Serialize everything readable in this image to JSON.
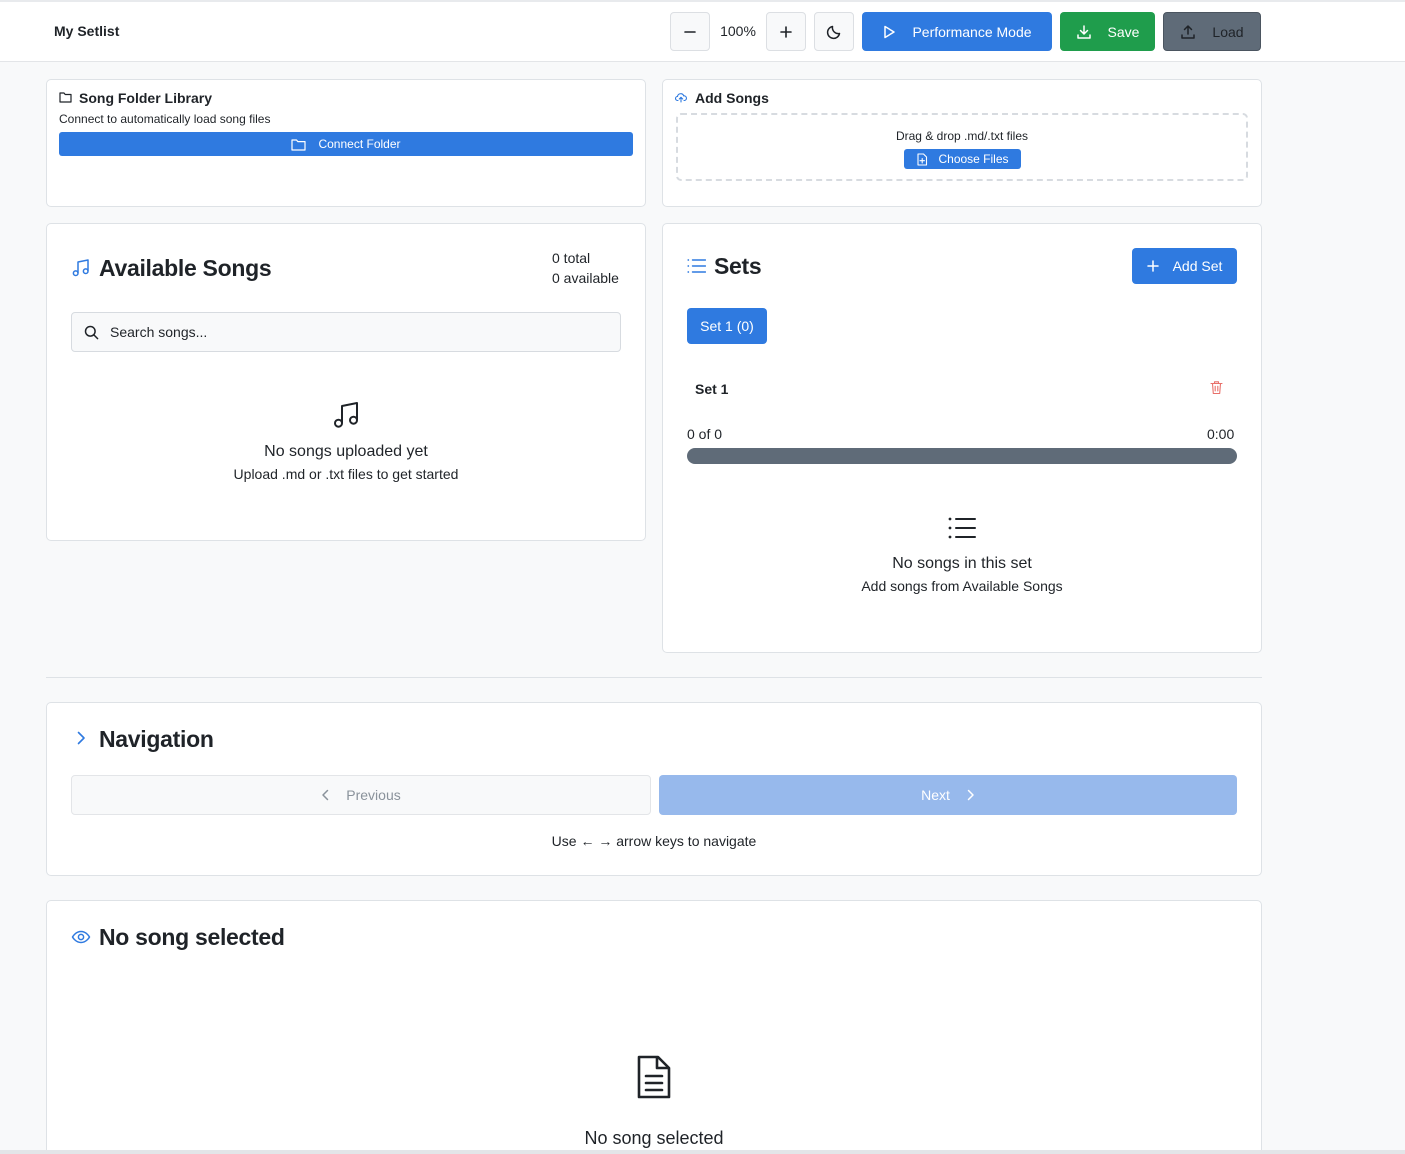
{
  "header": {
    "title": "My Setlist",
    "zoom_level": "100%",
    "performance_label": "Performance Mode",
    "save_label": "Save",
    "load_label": "Load"
  },
  "folder_library": {
    "title": "Song Folder Library",
    "description": "Connect to automatically load song files",
    "connect_label": "Connect Folder"
  },
  "add_songs": {
    "title": "Add Songs",
    "drop_text": "Drag & drop .md/.txt files",
    "choose_label": "Choose Files"
  },
  "available_songs": {
    "title": "Available Songs",
    "total": "0 total",
    "available": "0 available",
    "search_placeholder": "Search songs...",
    "empty_title": "No songs uploaded yet",
    "empty_subtitle": "Upload .md or .txt files to get started"
  },
  "sets": {
    "title": "Sets",
    "add_label": "Add Set",
    "tabs": [
      {
        "label": "Set 1 (0)",
        "active": true
      }
    ],
    "current": {
      "name": "Set 1",
      "count": "0 of 0",
      "duration": "0:00",
      "progress": 0
    },
    "empty_title": "No songs in this set",
    "empty_subtitle": "Add songs from Available Songs"
  },
  "navigation": {
    "title": "Navigation",
    "previous_label": "Previous",
    "next_label": "Next",
    "hint": "Use ← → arrow keys to navigate"
  },
  "viewer": {
    "title": "No song selected",
    "empty_title": "No song selected"
  },
  "colors": {
    "accent": "#2f7ae0",
    "save": "#1f9d4c",
    "load": "#5f6b78",
    "delete": "#e8706a",
    "next_disabled": "#97b9ec"
  },
  "icons": [
    "minus-icon",
    "plus-icon",
    "moon-icon",
    "play-icon",
    "download-icon",
    "upload-icon",
    "folder-icon",
    "cloud-upload-icon",
    "file-plus-icon",
    "music-note-icon",
    "search-icon",
    "list-icon",
    "trash-icon",
    "chevron-right-icon",
    "chevron-left-icon",
    "eye-icon",
    "file-text-icon"
  ]
}
